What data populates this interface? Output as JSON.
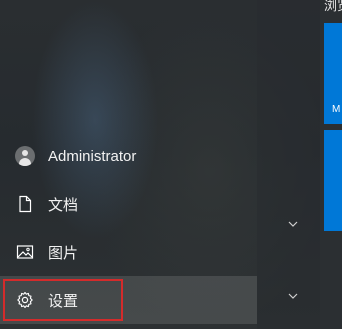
{
  "start_menu": {
    "user": {
      "label": "Administrator",
      "icon": "user-avatar-icon"
    },
    "items": [
      {
        "label": "文档",
        "icon": "document-icon"
      },
      {
        "label": "图片",
        "icon": "pictures-icon"
      },
      {
        "label": "设置",
        "icon": "gear-icon"
      }
    ],
    "highlight_color": "#d42b2b"
  },
  "tiles": {
    "group_title": "浏览",
    "tile1_label": "M",
    "tile_color": "#0078d7"
  }
}
